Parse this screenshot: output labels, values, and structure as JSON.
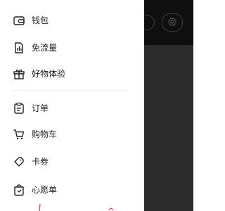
{
  "drawer_menu": {
    "items": [
      {
        "label": "钱包",
        "icon": "wallet-icon"
      },
      {
        "label": "免流量",
        "icon": "data-plan-icon"
      },
      {
        "label": "好物体验",
        "icon": "gift-icon"
      },
      {
        "label": "订单",
        "icon": "order-icon"
      },
      {
        "label": "购物车",
        "icon": "cart-icon"
      },
      {
        "label": "卡券",
        "icon": "coupon-icon"
      },
      {
        "label": "心愿单",
        "icon": "wishlist-icon"
      }
    ]
  },
  "background_header": {
    "icons": [
      "pill-button",
      "gear-icon"
    ]
  },
  "colors": {
    "drawer_bg": "#ffffff",
    "scrim": "#2b2b2b",
    "text": "#222222",
    "icon_stroke": "#222222",
    "accent": "#e0303a"
  }
}
